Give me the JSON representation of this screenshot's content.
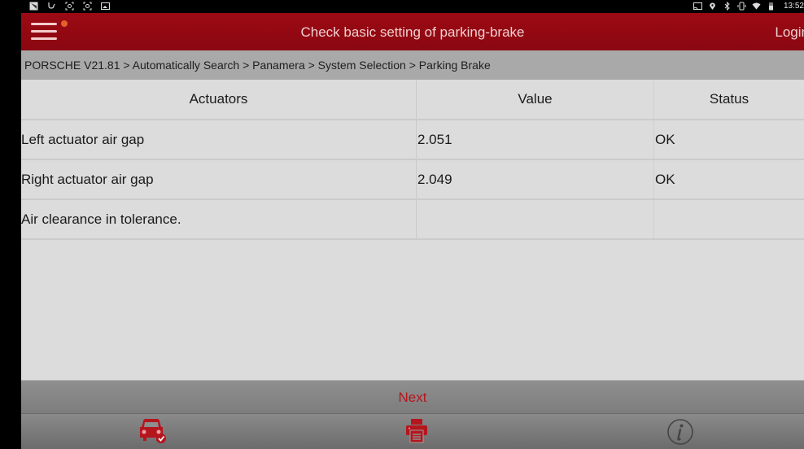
{
  "statusbar": {
    "left_icons": [
      "image-notification-icon",
      "stethoscope-icon",
      "screenshot-icon",
      "screenshot-icon",
      "gallery-icon"
    ],
    "right_icons": [
      "cast-icon",
      "location-icon",
      "bluetooth-icon",
      "vibrate-icon",
      "wifi-icon",
      "battery-icon"
    ],
    "time": "13:52"
  },
  "topbar": {
    "title": "Check basic setting of parking-brake",
    "login_label": "Login",
    "notification_dot_color": "#e0622a"
  },
  "breadcrumb": {
    "text": "PORSCHE V21.81 > Automatically Search > Panamera > System Selection > Parking Brake",
    "items": [
      "PORSCHE V21.81",
      "Automatically Search",
      "Panamera",
      "System Selection",
      "Parking Brake"
    ]
  },
  "table": {
    "columns": [
      "Actuators",
      "Value",
      "Status"
    ],
    "rows": [
      {
        "actuator": "Left actuator air gap",
        "value": "2.051",
        "status": "OK"
      },
      {
        "actuator": "Right actuator air gap",
        "value": "2.049",
        "status": "OK"
      },
      {
        "actuator": "Air clearance in tolerance.",
        "value": "",
        "status": ""
      }
    ]
  },
  "footer": {
    "next_label": "Next",
    "toolbar_icons": [
      "car-check-icon",
      "printer-icon",
      "info-icon"
    ]
  },
  "colors": {
    "brand_red": "#8f0812",
    "accent_red": "#b5161e",
    "header_text": "#f3d0d0"
  }
}
